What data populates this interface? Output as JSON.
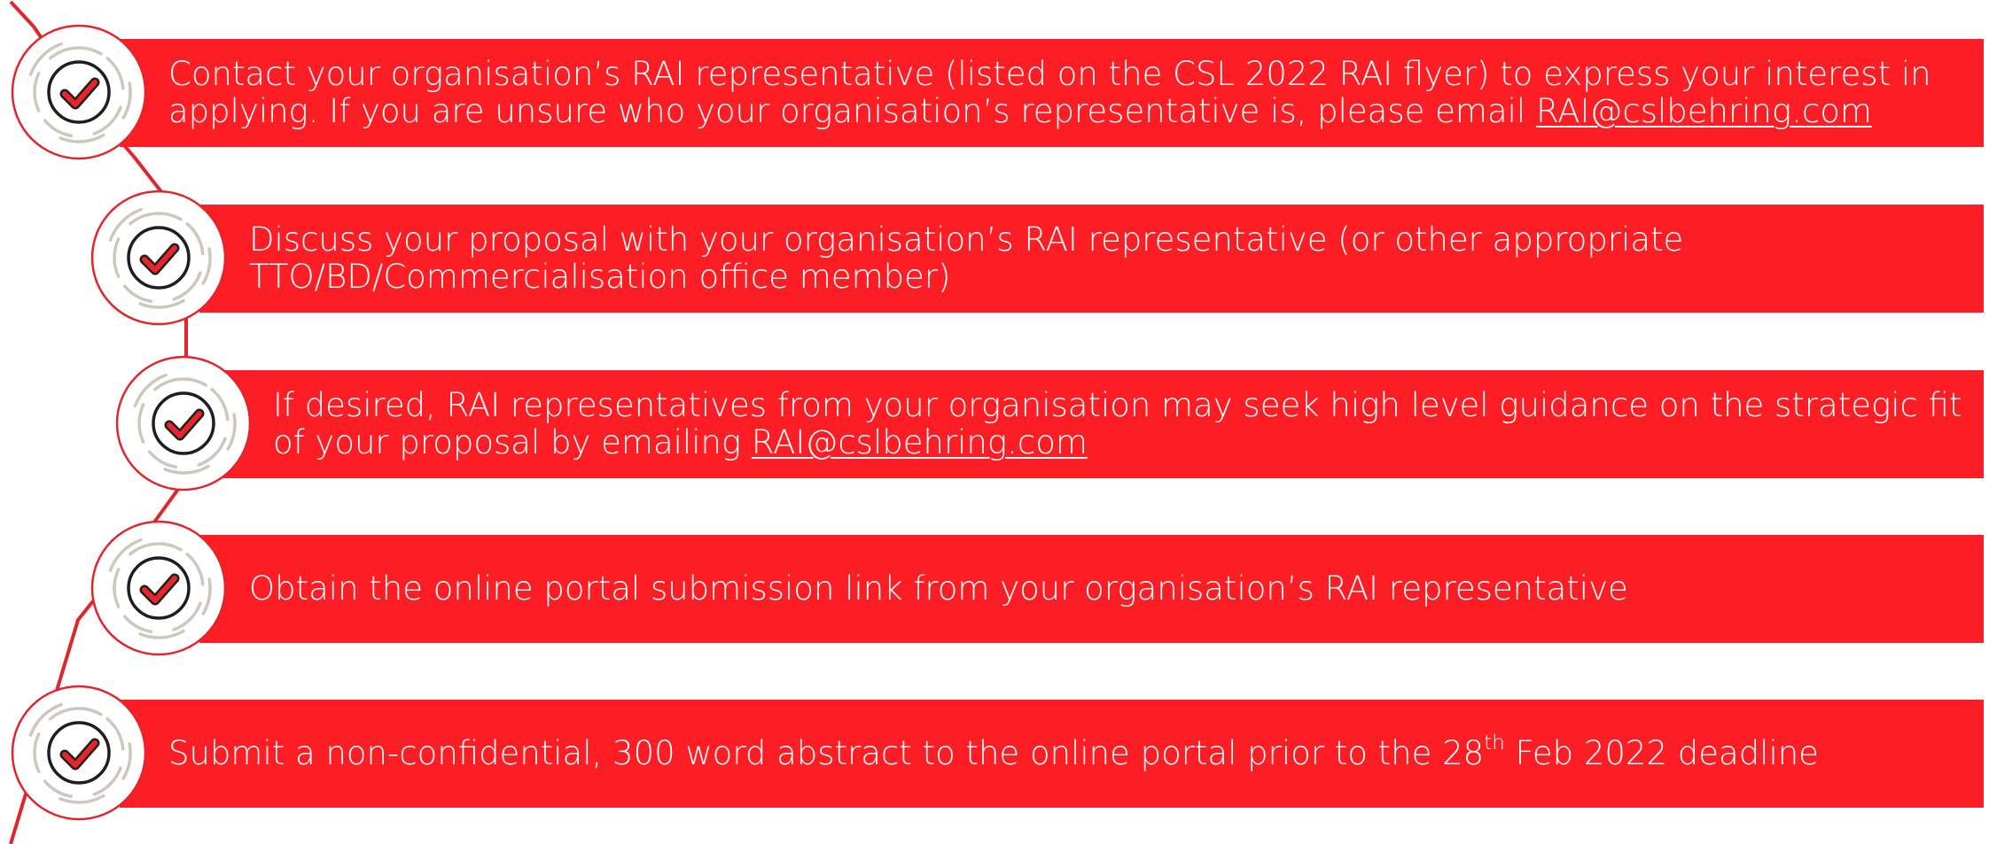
{
  "colors": {
    "bar": "#fd1d25",
    "badge_ring": "#e0262c",
    "arc": "#cdc7bd",
    "check": "#e8252b",
    "circle": "#1e1e1e",
    "text": "#ffffff"
  },
  "steps": [
    {
      "icon": "check-badge-icon",
      "line1": "Contact your organisation’s RAI representative (listed on the CSL 2022 RAI flyer) to express your interest in",
      "line2_pre": "applying. If you are unsure who your organisation’s representative is, please email ",
      "line2_link": "RAI@cslbehring.com"
    },
    {
      "icon": "check-badge-icon",
      "line1": "Discuss your proposal with your organisation’s RAI representative (or other appropriate",
      "line2": "TTO/BD/Commercialisation office member)"
    },
    {
      "icon": "check-badge-icon",
      "line1": "If desired, RAI representatives from your organisation may seek high level guidance on the strategic fit",
      "line2_pre": "of your proposal by emailing ",
      "line2_link": "RAI@cslbehring.com"
    },
    {
      "icon": "check-badge-icon",
      "line1": "Obtain the online portal submission link from your organisation’s RAI representative"
    },
    {
      "icon": "check-badge-icon",
      "pre": "Submit a non-confidential, 300 word abstract to the online portal prior to the 28",
      "sup": "th",
      "post": " Feb 2022 deadline"
    }
  ]
}
